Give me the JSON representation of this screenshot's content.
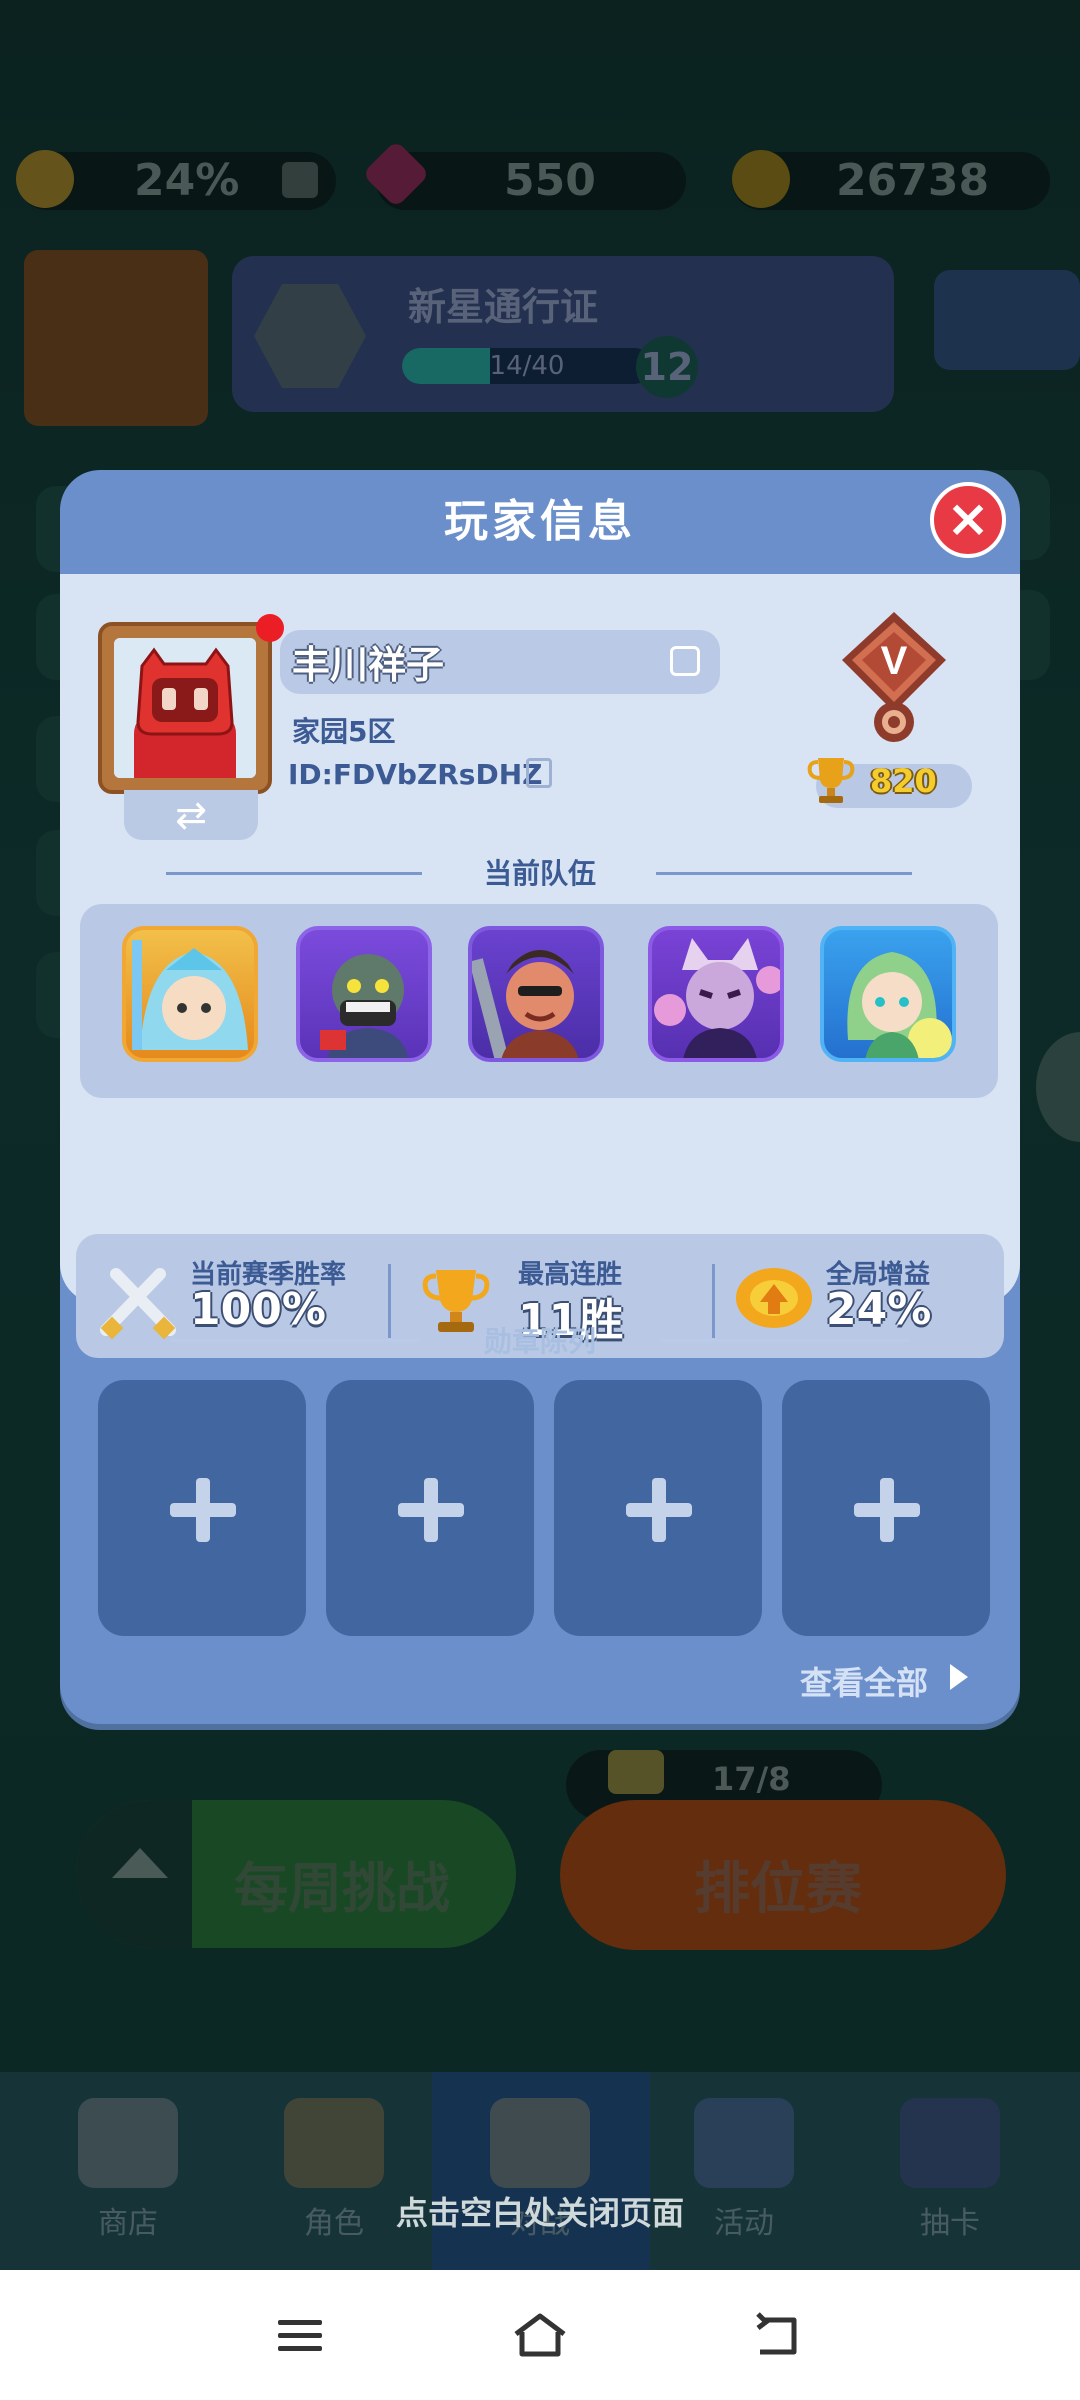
{
  "top_bar": {
    "boost_value": "24%",
    "gems_value": "550",
    "coins_value": "26738"
  },
  "pass": {
    "title": "新星通行证",
    "progress_text": "14/40",
    "progress_fraction": 0.35,
    "level": "12"
  },
  "lobby": {
    "weekly_challenge": "每周挑战",
    "ranked_match": "排位赛",
    "ticket_count": "17/8",
    "tabs": [
      "商店",
      "角色",
      "对战",
      "活动",
      "抽卡"
    ]
  },
  "panel": {
    "title": "玩家信息",
    "player_name": "丰川祥子",
    "server": "家园5区",
    "player_id": "ID:FDVbZRsDHZ",
    "rank_letter": "V",
    "trophies": "820",
    "team_title": "当前队伍",
    "stats": [
      {
        "label": "当前赛季胜率",
        "value": "100%"
      },
      {
        "label": "最高连胜",
        "value": "11胜"
      },
      {
        "label": "全局增益",
        "value": "24%"
      }
    ],
    "medal_title": "勋章陈列",
    "view_all": "查看全部"
  },
  "close_hint": "点击空白处关闭页面",
  "colors": {
    "panel_blue": "#6a8fcb",
    "card_light": "#d8e3f3",
    "close_red": "#e83a45",
    "trophy_gold": "#f4cc2e"
  }
}
